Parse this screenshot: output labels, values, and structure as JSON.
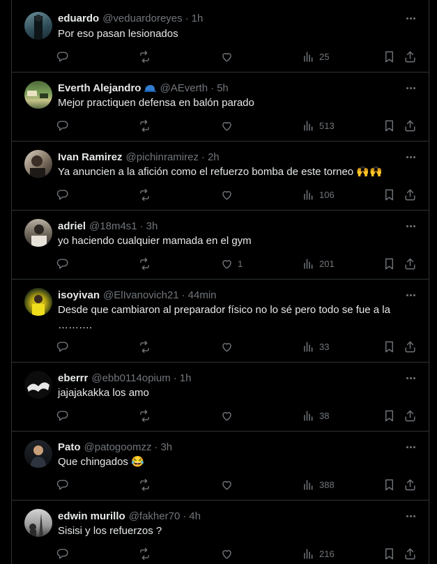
{
  "tweets": [
    {
      "name": "eduardo",
      "handle": "@veduardoreyes",
      "time": "1h",
      "text": "Por eso pasan lesionados",
      "likes": "",
      "views": "25",
      "badge": false
    },
    {
      "name": "Everth Alejandro",
      "handle": "@AEverth",
      "time": "5h",
      "text": "Mejor practiquen defensa en balón parado",
      "likes": "",
      "views": "513",
      "badge": true
    },
    {
      "name": "Ivan Ramirez",
      "handle": "@pichinramirez",
      "time": "2h",
      "text": "Ya anuncien a la afición como el refuerzo bomba de este torneo",
      "text_emoji": "🙌🙌",
      "likes": "",
      "views": "106",
      "badge": false
    },
    {
      "name": "adriel",
      "handle": "@18m4s1",
      "time": "3h",
      "text": "yo haciendo cualquier mamada en el gym",
      "likes": "1",
      "views": "201",
      "badge": false
    },
    {
      "name": "isoyivan",
      "handle": "@ElIvanovich21",
      "time": "44min",
      "text": "Desde que cambiaron al preparador físico no lo sé pero todo se fue a la ……….",
      "likes": "",
      "views": "33",
      "badge": false
    },
    {
      "name": "eberrr",
      "handle": "@ebb0114opium",
      "time": "1h",
      "text": "jajajakakka los amo",
      "likes": "",
      "views": "38",
      "badge": false
    },
    {
      "name": "Pato",
      "handle": "@patogoomzz",
      "time": "3h",
      "text": "Que chingados",
      "text_emoji": "😂",
      "likes": "",
      "views": "388",
      "badge": false
    },
    {
      "name": "edwin murillo",
      "handle": "@fakher70",
      "time": "4h",
      "text": "Sisisi y los refuerzos ?",
      "likes": "",
      "views": "216",
      "badge": false
    }
  ],
  "icons": {
    "reply": "reply-icon",
    "retweet": "retweet-icon",
    "like": "like-icon",
    "views": "views-icon",
    "bookmark": "bookmark-icon",
    "share": "share-icon",
    "more": "more-icon"
  },
  "colors": {
    "background": "#000000",
    "text": "#e7e9ea",
    "muted": "#71767b",
    "border": "#2f3336"
  }
}
